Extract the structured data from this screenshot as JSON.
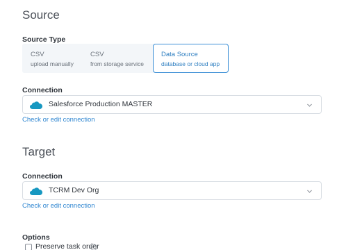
{
  "source": {
    "title": "Source",
    "type_label": "Source Type",
    "types": [
      {
        "title": "CSV",
        "subtitle": "upload manually",
        "selected": false
      },
      {
        "title": "CSV",
        "subtitle": "from storage service",
        "selected": false
      },
      {
        "title": "Data Source",
        "subtitle": "database or cloud app",
        "selected": true
      }
    ],
    "connection_label": "Connection",
    "connection_value": "Salesforce Production MASTER",
    "connection_icon": "salesforce-cloud-icon",
    "edit_link": "Check or edit connection"
  },
  "target": {
    "title": "Target",
    "connection_label": "Connection",
    "connection_value": "TCRM Dev Org",
    "connection_icon": "salesforce-cloud-icon",
    "edit_link": "Check or edit connection"
  },
  "options": {
    "label": "Options",
    "preserve_task_order": {
      "label": "Preserve task order",
      "checked": false,
      "icon": "info-icon"
    }
  },
  "colors": {
    "accent": "#2f86d1",
    "salesforce": "#1798c1",
    "border": "#d8dde3",
    "segment_bg": "#f3f6f9"
  }
}
